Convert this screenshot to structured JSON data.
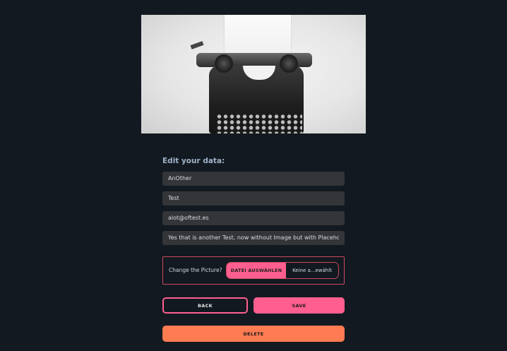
{
  "hero": {
    "image": "typewriter-photo"
  },
  "form": {
    "title": "Edit your data:",
    "fields": [
      {
        "value": "AnOther"
      },
      {
        "value": "Test"
      },
      {
        "value": "alot@oftest.es"
      },
      {
        "value": "Yes that is another Test, now without Image but with Placeholder"
      }
    ],
    "picture": {
      "label": "Change the Picture?",
      "choose_button": "DATEI AUSWÄHLEN",
      "file_status": "Keine a...ewählt"
    },
    "buttons": {
      "back": "BACK",
      "save": "SAVE",
      "delete": "DELETE"
    }
  },
  "colors": {
    "background": "#131920",
    "accent_pink": "#ff5f8f",
    "accent_orange": "#ff7b52",
    "field_bg": "#333538",
    "title_text": "#9fb2c8"
  }
}
